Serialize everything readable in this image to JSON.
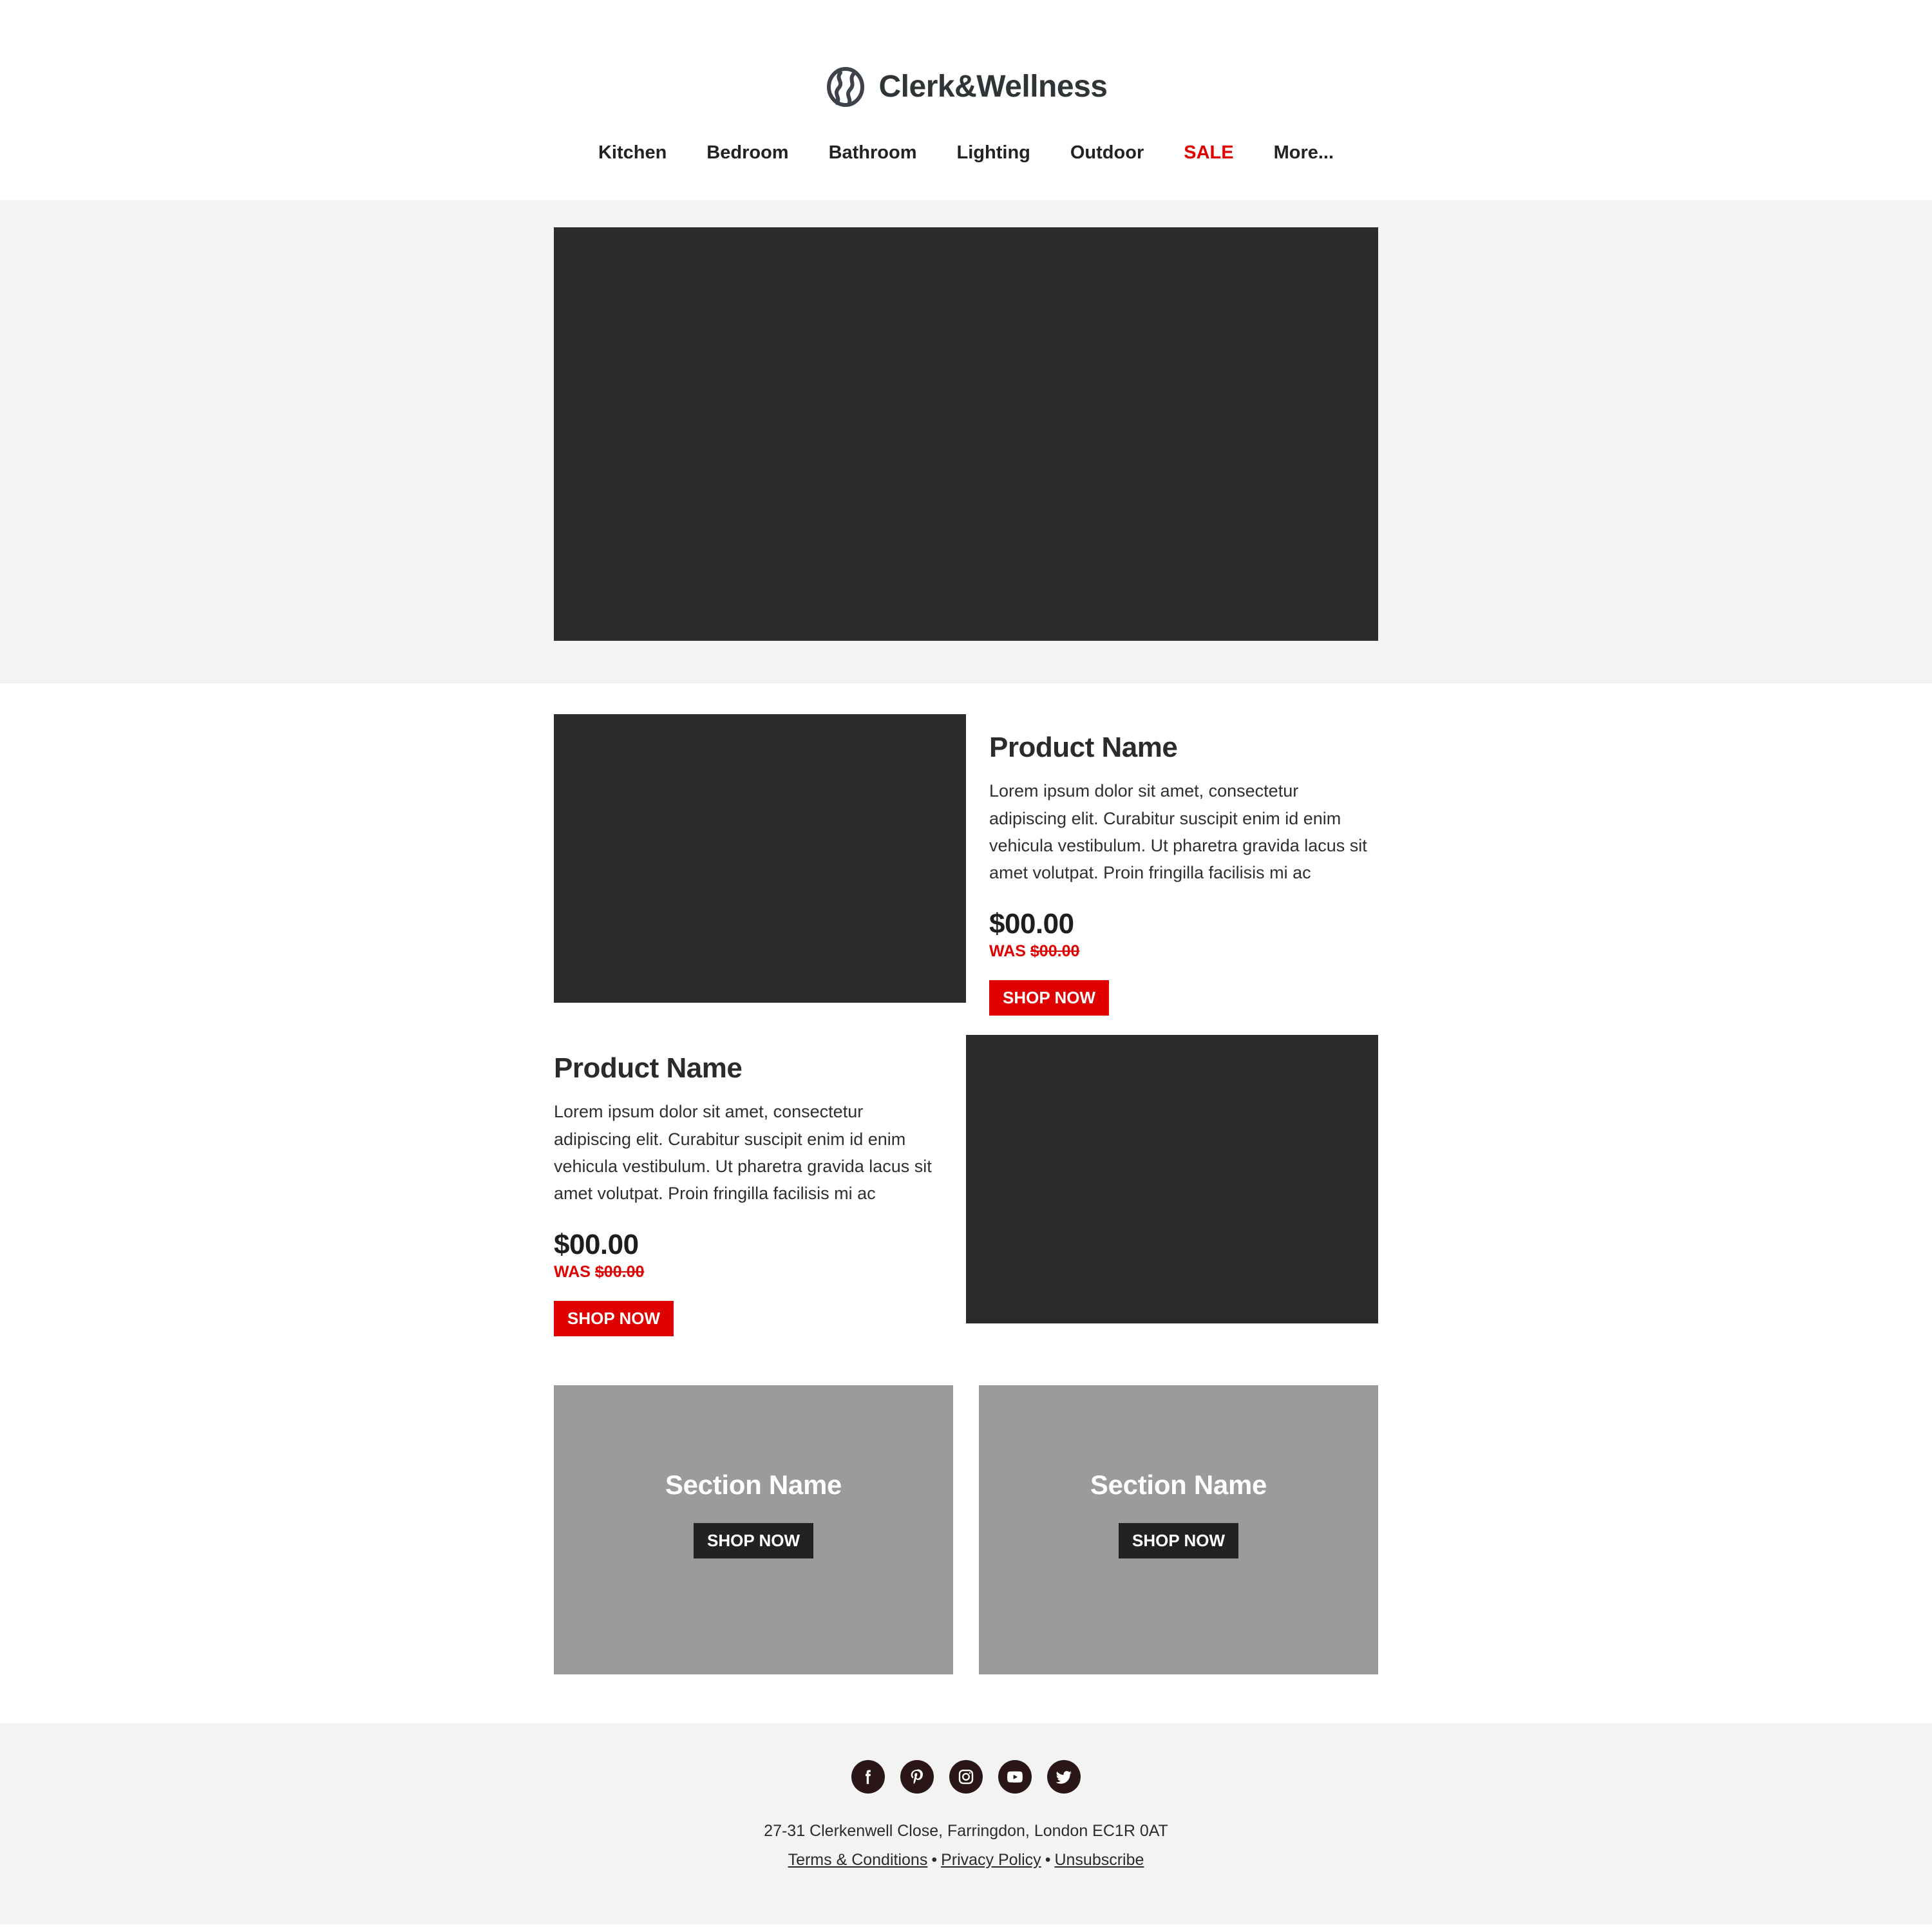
{
  "brand": {
    "name": "Clerk&Wellness",
    "logo_icon": "globe-wave-icon",
    "logo_color": "#2f3437"
  },
  "nav": {
    "items": [
      {
        "label": "Kitchen",
        "highlight": false
      },
      {
        "label": "Bedroom",
        "highlight": false
      },
      {
        "label": "Bathroom",
        "highlight": false
      },
      {
        "label": "Lighting",
        "highlight": false
      },
      {
        "label": "Outdoor",
        "highlight": false
      },
      {
        "label": "SALE",
        "highlight": true
      },
      {
        "label": "More...",
        "highlight": false
      }
    ],
    "sale_color": "#e00000"
  },
  "hero": {
    "image_placeholder": "hero-image",
    "band_color": "#f3f3f3",
    "image_color": "#2b2b2b"
  },
  "products": [
    {
      "image_side": "left",
      "title": "Product Name",
      "description": "Lorem ipsum dolor sit amet, consectetur adipiscing elit. Curabitur suscipit enim id enim vehicula vestibulum. Ut pharetra gravida lacus sit amet volutpat. Proin fringilla facilisis mi ac",
      "price": "$00.00",
      "was_label": "WAS",
      "was_price": "$00.00",
      "cta": "SHOP NOW"
    },
    {
      "image_side": "right",
      "title": "Product Name",
      "description": "Lorem ipsum dolor sit amet, consectetur adipiscing elit. Curabitur suscipit enim id enim vehicula vestibulum. Ut pharetra gravida lacus sit amet volutpat. Proin fringilla facilisis mi ac",
      "price": "$00.00",
      "was_label": "WAS",
      "was_price": "$00.00",
      "cta": "SHOP NOW"
    }
  ],
  "sections": [
    {
      "title": "Section Name",
      "cta": "SHOP NOW"
    },
    {
      "title": "Section Name",
      "cta": "SHOP NOW"
    }
  ],
  "footer": {
    "social": [
      {
        "name": "facebook-icon"
      },
      {
        "name": "pinterest-icon"
      },
      {
        "name": "instagram-icon"
      },
      {
        "name": "youtube-icon"
      },
      {
        "name": "twitter-icon"
      }
    ],
    "address": "27-31 Clerkenwell Close, Farringdon, London EC1R 0AT",
    "links": [
      {
        "label": "Terms & Conditions"
      },
      {
        "label": "Privacy Policy"
      },
      {
        "label": "Unsubscribe"
      }
    ],
    "separator": "•"
  },
  "colors": {
    "accent_red": "#e00000",
    "dark": "#2b2b2b",
    "gray_band": "#f3f3f3",
    "card_gray": "#9b9b9b"
  }
}
